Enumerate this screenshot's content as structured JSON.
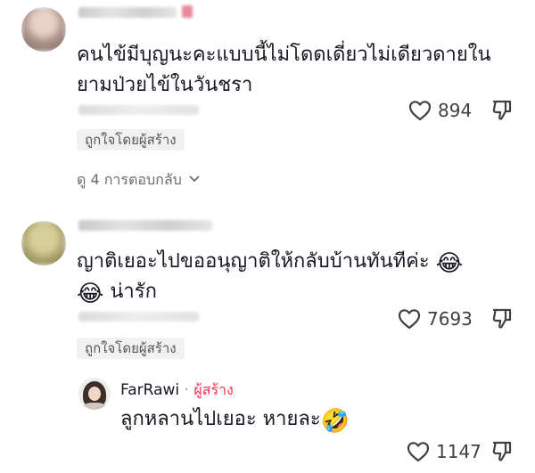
{
  "comments": [
    {
      "text_lines": [
        "คนไข้มีบุญนะคะแบบนี้ไม่โดดเดี่ยวไม่เดียวดายใน",
        "ยามป่วยไข้ในวันชรา"
      ],
      "likes": "894",
      "creator_liked": "ถูกใจโดยผู้สร้าง",
      "view_replies": "ดู 4 การตอบกลับ"
    },
    {
      "text_line1": "ญาติเยอะไปขออนุญาติให้กลับบ้านทันทีค่ะ",
      "text_line1_emoji": "😂",
      "text_line2_emoji": "😂",
      "text_line2": "น่ารัก",
      "likes": "7693",
      "creator_liked": "ถูกใจโดยผู้สร้าง"
    }
  ],
  "reply": {
    "author": "FarRawi",
    "separator": "·",
    "creator_tag": "ผู้สร้าง",
    "text": "ลูกหลานไปเยอะ หายละ",
    "emoji": "🤣",
    "likes": "1147"
  },
  "colors": {
    "creator_tag": "#fe2c55",
    "badge_bg": "#f1f1f2",
    "count": "#404040"
  },
  "icons": [
    "heart-icon",
    "dislike-icon",
    "chevron-down-icon"
  ]
}
